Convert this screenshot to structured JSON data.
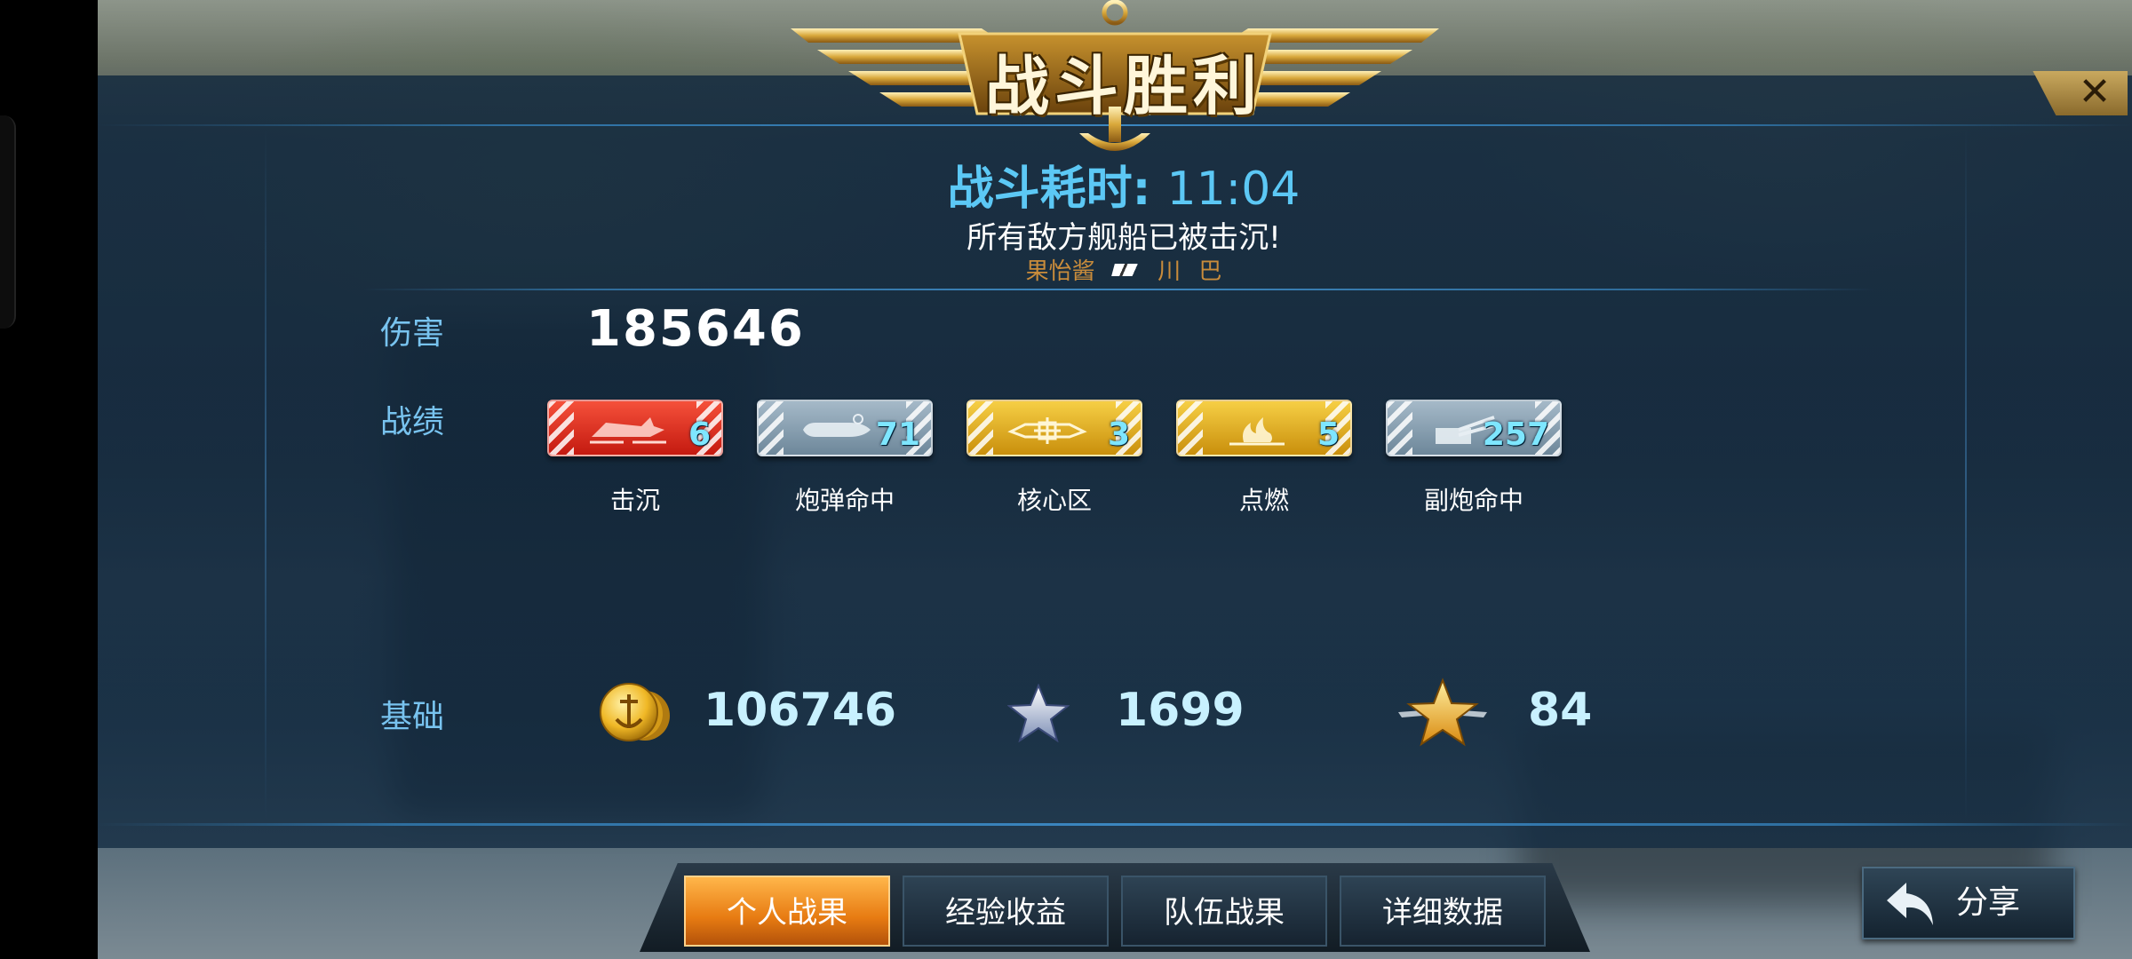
{
  "header": {
    "title": "战斗胜利"
  },
  "battle": {
    "time_label": "战斗耗时:",
    "time_value": "11:04",
    "message": "所有敌方舰船已被击沉!",
    "players": [
      "果怡酱",
      "川",
      "巴"
    ]
  },
  "damage": {
    "label": "伤害",
    "value": "185646"
  },
  "record": {
    "label": "战绩",
    "items": [
      {
        "caption": "击沉",
        "value": "6",
        "icon": "sink-ship-icon",
        "color": "#d8281a"
      },
      {
        "caption": "炮弹命中",
        "value": "71",
        "icon": "shell-icon",
        "color": "#8aa2b5"
      },
      {
        "caption": "核心区",
        "value": "3",
        "icon": "core-zone-icon",
        "color": "#e0aa20"
      },
      {
        "caption": "点燃",
        "value": "5",
        "icon": "fire-icon",
        "color": "#e0aa20"
      },
      {
        "caption": "副炮命中",
        "value": "257",
        "icon": "secondary-gun-icon",
        "color": "#8aa2b5"
      }
    ]
  },
  "base": {
    "label": "基础",
    "coins": "106746",
    "exp": "1699",
    "rank_points": "84"
  },
  "tabs": [
    {
      "label": "个人战果",
      "active": true
    },
    {
      "label": "经验收益",
      "active": false
    },
    {
      "label": "队伍战果",
      "active": false
    },
    {
      "label": "详细数据",
      "active": false
    }
  ],
  "share": {
    "label": "分享"
  },
  "close": {
    "label": "✕"
  }
}
